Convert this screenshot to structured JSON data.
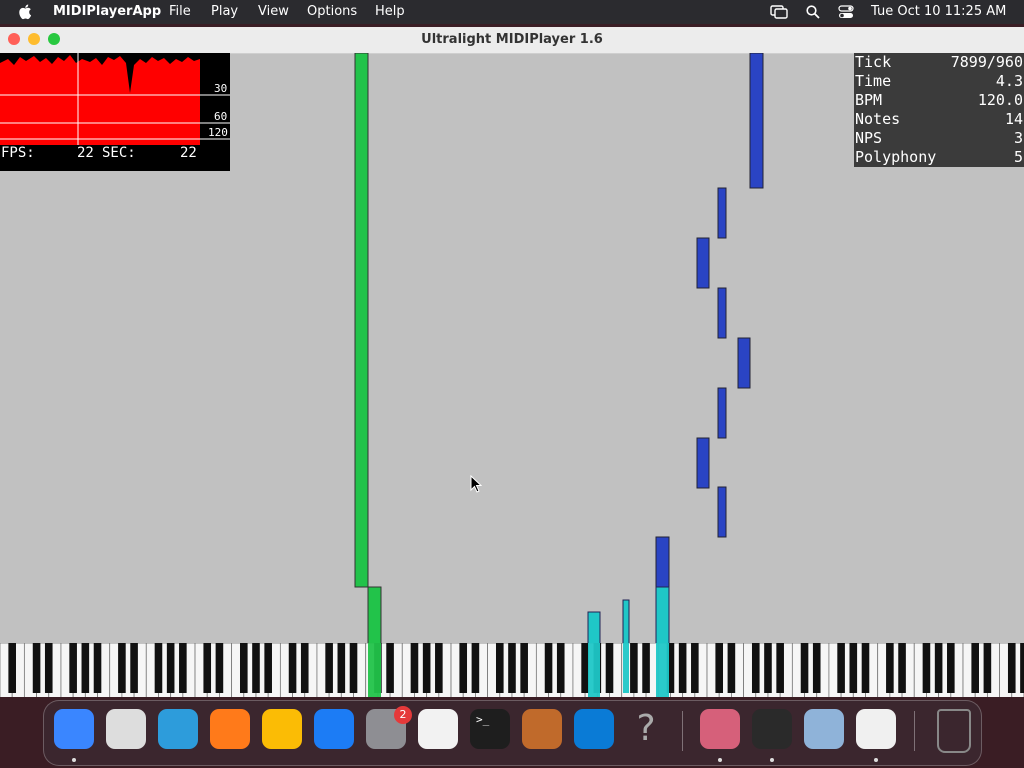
{
  "menubar": {
    "app_name": "MIDIPlayerApp",
    "menus": [
      "File",
      "Play",
      "View",
      "Options",
      "Help"
    ],
    "datetime": "Tue Oct 10  11:25 AM",
    "icons": [
      "screen-mirroring-icon",
      "search-icon",
      "control-center-icon"
    ]
  },
  "window": {
    "title": "Ultralight MIDIPlayer 1.6",
    "traffic_lights": {
      "close": "#ff5f57",
      "minimize": "#febc2e",
      "zoom": "#28c840"
    }
  },
  "fps_overlay": {
    "graph_labels": [
      "30",
      "60",
      "120"
    ],
    "fps_label": "FPS:",
    "fps_value": "22",
    "sec_label": "SEC:",
    "sec_value": "22",
    "graph_color": "#ff0000"
  },
  "stats": [
    {
      "label": "Tick",
      "value": "7899/960"
    },
    {
      "label": "Time",
      "value": "4.3"
    },
    {
      "label": "BPM",
      "value": "120.0"
    },
    {
      "label": "Notes",
      "value": "14"
    },
    {
      "label": "NPS",
      "value": "3"
    },
    {
      "label": "Polyphony",
      "value": "5"
    }
  ],
  "colors": {
    "background": "#c1c1c1",
    "green_note": "#22c34a",
    "blue_note": "#2a44c4",
    "cyan_note": "#1fc7c7"
  },
  "dock": {
    "apps": [
      {
        "name": "finder-icon",
        "running": true
      },
      {
        "name": "launchpad-icon",
        "running": false
      },
      {
        "name": "safari-icon",
        "running": false
      },
      {
        "name": "firefox-icon",
        "running": false
      },
      {
        "name": "chrome-icon",
        "running": false
      },
      {
        "name": "app-store-icon",
        "running": false
      },
      {
        "name": "system-settings-icon",
        "running": false,
        "badge": "2"
      },
      {
        "name": "textedit-icon",
        "running": false
      },
      {
        "name": "terminal-icon",
        "running": false
      },
      {
        "name": "garageband-icon",
        "running": false
      },
      {
        "name": "vscode-icon",
        "running": false
      },
      {
        "name": "help-question-icon",
        "running": false
      },
      {
        "name": "pink-app-icon",
        "running": true
      },
      {
        "name": "midi-player-icon",
        "running": true
      },
      {
        "name": "preview-icon",
        "running": false
      },
      {
        "name": "java-icon",
        "running": true
      },
      {
        "name": "trash-icon",
        "running": false
      }
    ]
  }
}
